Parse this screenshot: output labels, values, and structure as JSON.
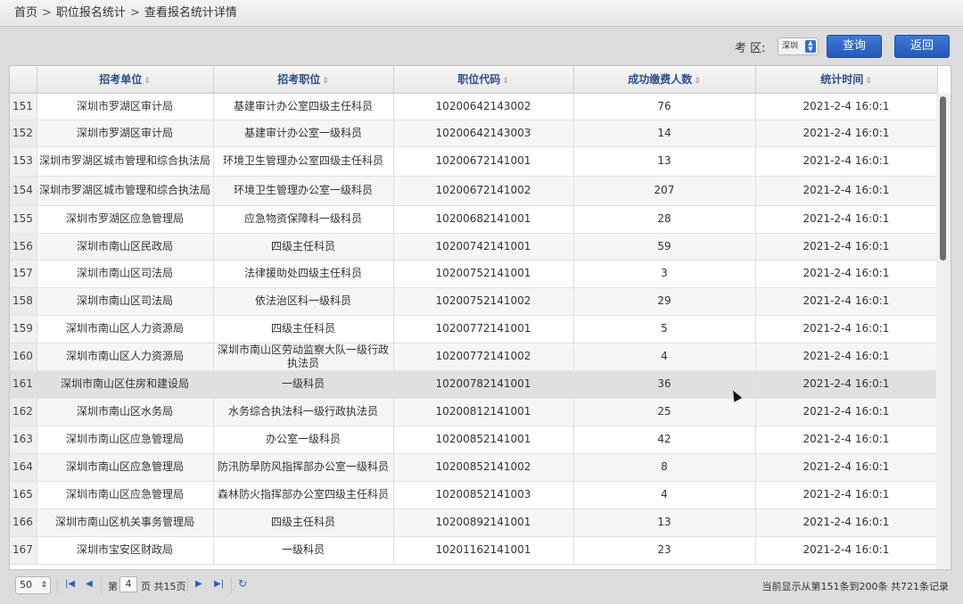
{
  "breadcrumb": [
    "首页",
    "职位报名统计",
    "查看报名统计详情"
  ],
  "breadcrumb_separator": ">",
  "toolbar": {
    "area_label": "考 区:",
    "area_value": "深圳",
    "query_label": "查询",
    "back_label": "返回",
    "accent_color": "#2f6fd6"
  },
  "table": {
    "columns": [
      "招考单位",
      "招考职位",
      "职位代码",
      "成功缴费人数",
      "统计时间"
    ],
    "sort_icon": "⇕",
    "rows": [
      {
        "n": "151",
        "unit": "深圳市罗湖区审计局",
        "pos": "基建审计办公室四级主任科员",
        "code": "10200642143002",
        "count": "76",
        "time": "2021-2-4 16:0:1"
      },
      {
        "n": "152",
        "unit": "深圳市罗湖区审计局",
        "pos": "基建审计办公室一级科员",
        "code": "10200642143003",
        "count": "14",
        "time": "2021-2-4 16:0:1"
      },
      {
        "n": "153",
        "unit": "深圳市罗湖区城市管理和综合执法局",
        "pos": "环境卫生管理办公室四级主任科员",
        "code": "10200672141001",
        "count": "13",
        "time": "2021-2-4 16:0:1"
      },
      {
        "n": "154",
        "unit": "深圳市罗湖区城市管理和综合执法局",
        "pos": "环境卫生管理办公室一级科员",
        "code": "10200672141002",
        "count": "207",
        "time": "2021-2-4 16:0:1"
      },
      {
        "n": "155",
        "unit": "深圳市罗湖区应急管理局",
        "pos": "应急物资保障科一级科员",
        "code": "10200682141001",
        "count": "28",
        "time": "2021-2-4 16:0:1"
      },
      {
        "n": "156",
        "unit": "深圳市南山区民政局",
        "pos": "四级主任科员",
        "code": "10200742141001",
        "count": "59",
        "time": "2021-2-4 16:0:1"
      },
      {
        "n": "157",
        "unit": "深圳市南山区司法局",
        "pos": "法律援助处四级主任科员",
        "code": "10200752141001",
        "count": "3",
        "time": "2021-2-4 16:0:1"
      },
      {
        "n": "158",
        "unit": "深圳市南山区司法局",
        "pos": "依法治区科一级科员",
        "code": "10200752141002",
        "count": "29",
        "time": "2021-2-4 16:0:1"
      },
      {
        "n": "159",
        "unit": "深圳市南山区人力资源局",
        "pos": "四级主任科员",
        "code": "10200772141001",
        "count": "5",
        "time": "2021-2-4 16:0:1"
      },
      {
        "n": "160",
        "unit": "深圳市南山区人力资源局",
        "pos": "深圳市南山区劳动监察大队一级行政执法员",
        "code": "10200772141002",
        "count": "4",
        "time": "2021-2-4 16:0:1"
      },
      {
        "n": "161",
        "unit": "深圳市南山区住房和建设局",
        "pos": "一级科员",
        "code": "10200782141001",
        "count": "36",
        "time": "2021-2-4 16:0:1"
      },
      {
        "n": "162",
        "unit": "深圳市南山区水务局",
        "pos": "水务综合执法科一级行政执法员",
        "code": "10200812141001",
        "count": "25",
        "time": "2021-2-4 16:0:1"
      },
      {
        "n": "163",
        "unit": "深圳市南山区应急管理局",
        "pos": "办公室一级科员",
        "code": "10200852141001",
        "count": "42",
        "time": "2021-2-4 16:0:1"
      },
      {
        "n": "164",
        "unit": "深圳市南山区应急管理局",
        "pos": "防汛防旱防风指挥部办公室一级科员",
        "code": "10200852141002",
        "count": "8",
        "time": "2021-2-4 16:0:1"
      },
      {
        "n": "165",
        "unit": "深圳市南山区应急管理局",
        "pos": "森林防火指挥部办公室四级主任科员",
        "code": "10200852141003",
        "count": "4",
        "time": "2021-2-4 16:0:1"
      },
      {
        "n": "166",
        "unit": "深圳市南山区机关事务管理局",
        "pos": "四级主任科员",
        "code": "10200892141001",
        "count": "13",
        "time": "2021-2-4 16:0:1"
      },
      {
        "n": "167",
        "unit": "深圳市宝安区财政局",
        "pos": "一级科员",
        "code": "10201162141001",
        "count": "23",
        "time": "2021-2-4 16:0:1"
      }
    ]
  },
  "pager": {
    "page_size": "50",
    "page_prefix": "第",
    "page_number": "4",
    "page_suffix": "页 共15页",
    "info": "当前显示从第151条到200条 共721条记录"
  }
}
